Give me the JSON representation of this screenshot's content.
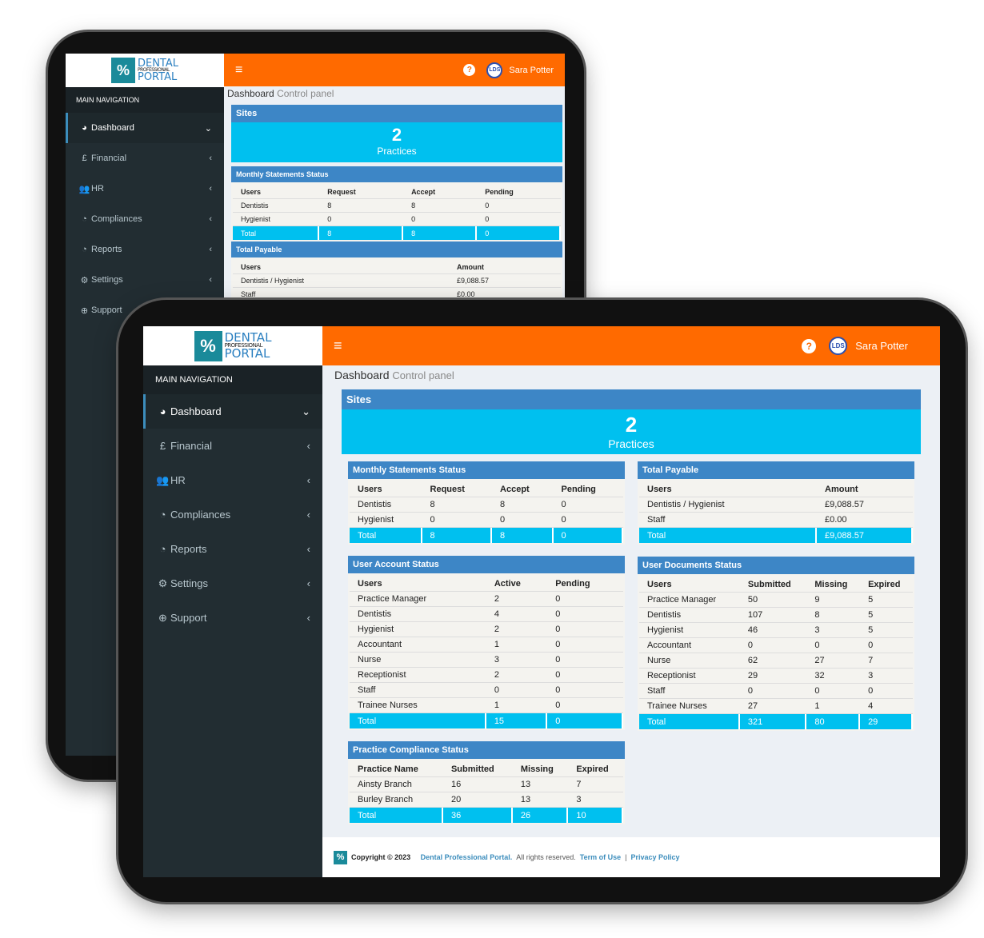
{
  "logo": {
    "line1": "DENTAL",
    "line2": "PROFESSIONAL",
    "line3": "PORTAL"
  },
  "sidebar": {
    "heading": "MAIN NAVIGATION",
    "items": [
      {
        "label": "Dashboard",
        "icon": "dashboard-icon",
        "glyph": "◕",
        "chev": "⌄"
      },
      {
        "label": "Financial",
        "icon": "pound-icon",
        "glyph": "£",
        "chev": "‹"
      },
      {
        "label": "HR",
        "icon": "users-icon",
        "glyph": "👥",
        "chev": "‹"
      },
      {
        "label": "Compliances",
        "icon": "pie-chart-icon",
        "glyph": "◔",
        "chev": "‹"
      },
      {
        "label": "Reports",
        "icon": "pie-chart-icon",
        "glyph": "◔",
        "chev": "‹"
      },
      {
        "label": "Settings",
        "icon": "gear-icon",
        "glyph": "⚙",
        "chev": "‹"
      },
      {
        "label": "Support",
        "icon": "lifebuoy-icon",
        "glyph": "⊕",
        "chev": "‹"
      }
    ]
  },
  "header": {
    "menu_icon": "≡",
    "help": "?",
    "avatar": "LDS",
    "user": "Sara Potter"
  },
  "page": {
    "title": "Dashboard",
    "subtitle": "Control panel"
  },
  "sites": {
    "title": "Sites",
    "count": "2",
    "label": "Practices"
  },
  "tables": {
    "monthly": {
      "title": "Monthly Statements Status",
      "cols": [
        "Users",
        "Request",
        "Accept",
        "Pending"
      ],
      "rows": [
        [
          "Dentistis",
          "8",
          "8",
          "0"
        ],
        [
          "Hygienist",
          "0",
          "0",
          "0"
        ]
      ],
      "total": [
        "Total",
        "8",
        "8",
        "0"
      ]
    },
    "payable": {
      "title": "Total Payable",
      "cols": [
        "Users",
        "Amount"
      ],
      "rows": [
        [
          "Dentistis / Hygienist",
          "£9,088.57"
        ],
        [
          "Staff",
          "£0.00"
        ]
      ],
      "total": [
        "Total",
        "£9,088.57"
      ]
    },
    "account": {
      "title": "User Account Status",
      "cols": [
        "Users",
        "Active",
        "Pending"
      ],
      "rows": [
        [
          "Practice Manager",
          "2",
          "0"
        ],
        [
          "Dentistis",
          "4",
          "0"
        ],
        [
          "Hygienist",
          "2",
          "0"
        ],
        [
          "Accountant",
          "1",
          "0"
        ],
        [
          "Nurse",
          "3",
          "0"
        ],
        [
          "Receptionist",
          "2",
          "0"
        ],
        [
          "Staff",
          "0",
          "0"
        ],
        [
          "Trainee Nurses",
          "1",
          "0"
        ]
      ],
      "total": [
        "Total",
        "15",
        "0"
      ]
    },
    "documents": {
      "title": "User Documents Status",
      "cols": [
        "Users",
        "Submitted",
        "Missing",
        "Expired"
      ],
      "rows": [
        [
          "Practice Manager",
          "50",
          "9",
          "5"
        ],
        [
          "Dentistis",
          "107",
          "8",
          "5"
        ],
        [
          "Hygienist",
          "46",
          "3",
          "5"
        ],
        [
          "Accountant",
          "0",
          "0",
          "0"
        ],
        [
          "Nurse",
          "62",
          "27",
          "7"
        ],
        [
          "Receptionist",
          "29",
          "32",
          "3"
        ],
        [
          "Staff",
          "0",
          "0",
          "0"
        ],
        [
          "Trainee Nurses",
          "27",
          "1",
          "4"
        ]
      ],
      "total": [
        "Total",
        "321",
        "80",
        "29"
      ]
    },
    "compliance": {
      "title": "Practice Compliance Status",
      "cols": [
        "Practice Name",
        "Submitted",
        "Missing",
        "Expired"
      ],
      "rows": [
        [
          "Ainsty Branch",
          "16",
          "13",
          "7"
        ],
        [
          "Burley Branch",
          "20",
          "13",
          "3"
        ]
      ],
      "total": [
        "Total",
        "36",
        "26",
        "10"
      ]
    }
  },
  "footer": {
    "copyright": "Copyright © 2023",
    "brand": "Dental Professional Portal.",
    "rights": "All rights reserved.",
    "terms": "Term of Use",
    "sep": "|",
    "privacy": "Privacy Policy"
  },
  "colors": {
    "header": "#ff6a00",
    "sidebar": "#222d32",
    "panel_head": "#3d86c6",
    "cyan": "#00c0ef"
  }
}
